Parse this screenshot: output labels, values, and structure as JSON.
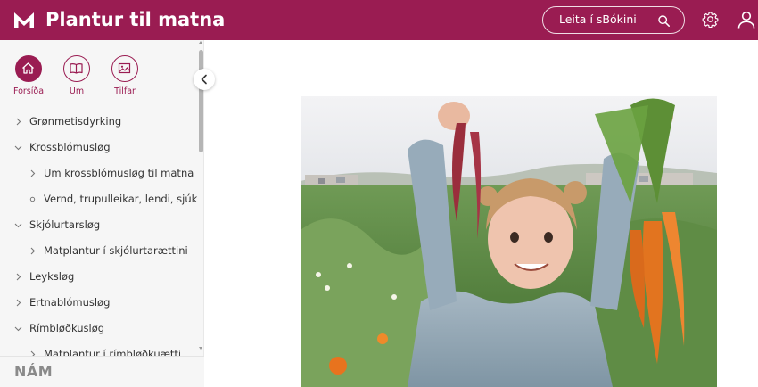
{
  "header": {
    "title": "Plantur til matna",
    "search_label": "Leita í sBókini",
    "logo_icon": "m-logo-icon",
    "settings_icon": "gear-icon",
    "user_icon": "user-icon",
    "brand_color": "#9a1c52"
  },
  "sidebar": {
    "nav": [
      {
        "label": "Forsíða",
        "icon": "home-icon",
        "active": true
      },
      {
        "label": "Um",
        "icon": "book-icon",
        "active": false
      },
      {
        "label": "Tilfar",
        "icon": "image-icon",
        "active": false
      }
    ],
    "toc": [
      {
        "label": "Grønmetisdyrking",
        "expanded": false,
        "level": 0
      },
      {
        "label": "Krossblómusløg",
        "expanded": true,
        "level": 0
      },
      {
        "label": "Um krossblómusløg til matna",
        "expanded": false,
        "level": 1
      },
      {
        "label": "Vernd, trupulleikar, lendi, sjúk…",
        "expanded": false,
        "level": 1,
        "bullet": true
      },
      {
        "label": "Skjólurtarsløg",
        "expanded": true,
        "level": 0
      },
      {
        "label": "Matplantur í skjólurtarættini",
        "expanded": false,
        "level": 1
      },
      {
        "label": "Leyksløg",
        "expanded": false,
        "level": 0
      },
      {
        "label": "Ertnablómusløg",
        "expanded": false,
        "level": 0
      },
      {
        "label": "Rímbløðkusløg",
        "expanded": true,
        "level": 0
      },
      {
        "label": "Matplantur í rímbløðkuættini",
        "expanded": false,
        "level": 1
      }
    ],
    "footer_logo": "NÁM"
  },
  "main": {
    "image_alt": "Child holding up freshly harvested carrots in a garden"
  }
}
